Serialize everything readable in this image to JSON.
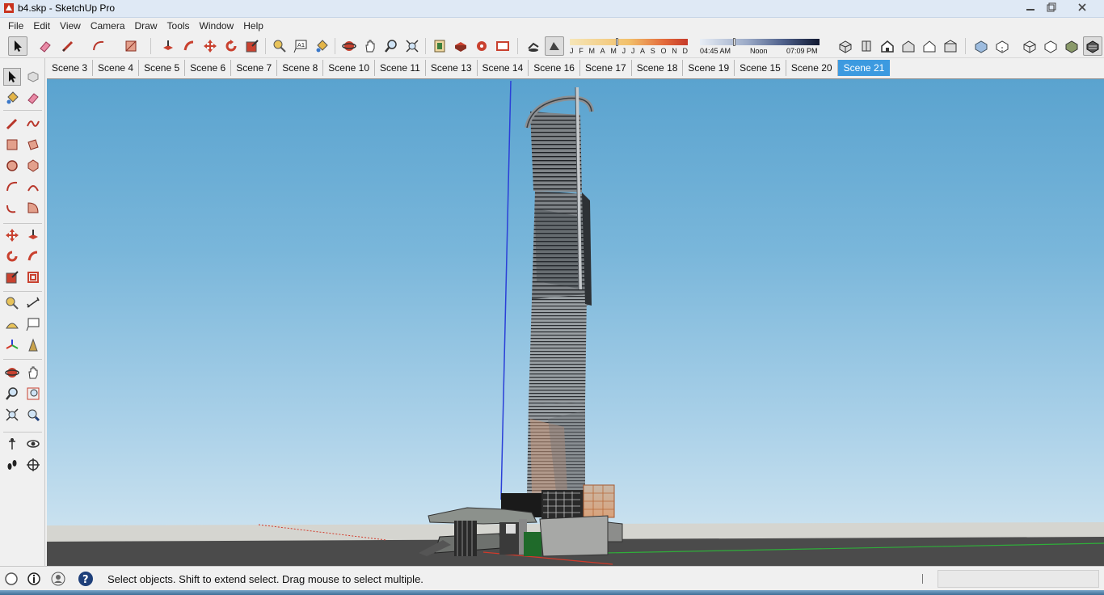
{
  "window": {
    "title": "b4.skp - SketchUp Pro",
    "minimize_label": "▭",
    "maximize_label": "❐",
    "close_label": "✕"
  },
  "menu": {
    "items": [
      "File",
      "Edit",
      "View",
      "Camera",
      "Draw",
      "Tools",
      "Window",
      "Help"
    ]
  },
  "toolbar": {
    "tools": [
      {
        "icon": "select-arrow-icon",
        "active": true
      },
      {
        "icon": "eraser-icon"
      },
      {
        "icon": "pencil-line-icon"
      },
      {
        "icon": "arc-icon"
      },
      {
        "icon": "rectangle-icon"
      },
      {
        "icon": "push-pull-icon"
      },
      {
        "icon": "follow-me-icon"
      },
      {
        "icon": "move-icon"
      },
      {
        "icon": "rotate-icon"
      },
      {
        "icon": "scale-icon"
      },
      {
        "icon": "tape-measure-icon"
      },
      {
        "icon": "text-icon"
      },
      {
        "icon": "paint-bucket-icon"
      },
      {
        "icon": "orbit-icon"
      },
      {
        "icon": "pan-icon"
      },
      {
        "icon": "zoom-icon"
      },
      {
        "icon": "zoom-extents-icon"
      },
      {
        "icon": "3d-warehouse-icon"
      },
      {
        "icon": "components-icon"
      },
      {
        "icon": "extension-warehouse-icon"
      },
      {
        "icon": "layout-icon"
      },
      {
        "icon": "shadows-toggle-icon"
      },
      {
        "icon": "fog-toggle-icon"
      }
    ],
    "views": [
      {
        "icon": "iso-view-icon"
      },
      {
        "icon": "top-view-icon"
      },
      {
        "icon": "front-view-icon"
      },
      {
        "icon": "right-view-icon"
      },
      {
        "icon": "back-view-icon"
      },
      {
        "icon": "left-view-icon"
      },
      {
        "icon": "xray-style-icon"
      },
      {
        "icon": "back-edges-style-icon"
      },
      {
        "icon": "wireframe-style-icon"
      },
      {
        "icon": "hidden-line-style-icon"
      },
      {
        "icon": "shaded-style-icon"
      },
      {
        "icon": "shaded-textures-style-icon"
      }
    ]
  },
  "shadows": {
    "months": [
      "J",
      "F",
      "M",
      "A",
      "M",
      "J",
      "J",
      "A",
      "S",
      "O",
      "N",
      "D"
    ],
    "month_position": 0.4,
    "time_start": "04:45 AM",
    "time_mid": "Noon",
    "time_end": "07:09 PM",
    "time_position": 0.28
  },
  "scenes": {
    "tabs": [
      "Scene 3",
      "Scene 4",
      "Scene 5",
      "Scene 6",
      "Scene 7",
      "Scene 8",
      "Scene 10",
      "Scene 11",
      "Scene 13",
      "Scene 14",
      "Scene 16",
      "Scene 17",
      "Scene 18",
      "Scene 19",
      "Scene 15",
      "Scene 20",
      "Scene 21"
    ],
    "active": "Scene 21"
  },
  "left_toolbar": {
    "tools": [
      "select-icon",
      "make-component-icon",
      "paint-bucket-icon",
      "eraser-icon",
      "line-icon",
      "freehand-icon",
      "rectangle-icon",
      "rotated-rectangle-icon",
      "circle-icon",
      "polygon-icon",
      "arc-icon",
      "2-point-arc-icon",
      "3-point-arc-icon",
      "pie-icon",
      "move-icon",
      "push-pull-icon",
      "rotate-icon",
      "follow-me-icon",
      "scale-icon",
      "offset-icon",
      "tape-measure-icon",
      "dimension-icon",
      "protractor-icon",
      "text-icon",
      "axes-icon",
      "3d-text-icon",
      "orbit-icon",
      "pan-icon",
      "zoom-icon",
      "zoom-window-icon",
      "zoom-extents-icon",
      "previous-view-icon",
      "position-camera-icon",
      "look-around-icon",
      "walk-icon",
      "section-plane-icon"
    ]
  },
  "status": {
    "message": "Select objects. Shift to extend select. Drag mouse to select multiple.",
    "icons": [
      "geo-location-icon",
      "credits-icon",
      "user-account-icon",
      "help-icon"
    ],
    "measurements_value": ""
  },
  "colors": {
    "scene_active": "#3c9ae0",
    "sky_top": "#5aa3cf",
    "sky_bottom": "#c9e1ef",
    "ground": "#4c4c4c",
    "blue_axis": "#2a3fd8",
    "red_axis": "#d23a2a",
    "green_axis": "#2fae3a"
  }
}
